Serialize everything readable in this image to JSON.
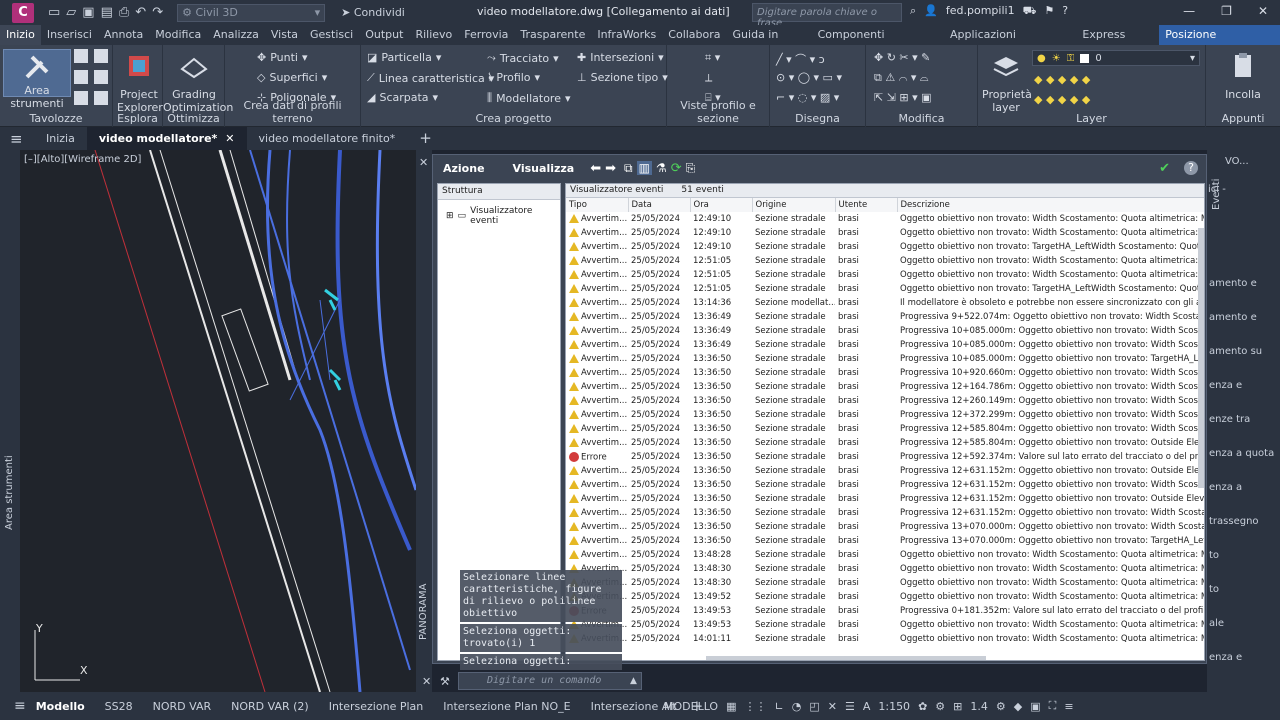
{
  "titlebar": {
    "app_letter": "C",
    "workspace": "Civil 3D",
    "share": "Condividi",
    "document_title": "video modellatore.dwg [Collegamento ai dati]",
    "search_placeholder": "Digitare parola chiave o frase",
    "user": "fed.pompili1"
  },
  "ribbon_tabs": [
    "Inizio",
    "Inserisci",
    "Annota",
    "Modifica",
    "Analizza",
    "Vista",
    "Gestisci",
    "Output",
    "Rilievo",
    "Ferrovia",
    "Trasparente",
    "InfraWorks",
    "Collabora",
    "Guida in linea",
    "Componenti aggiuntivi",
    "Applicazioni disponibili",
    "Express Tools",
    "Posizione geografica"
  ],
  "ribbon": {
    "area_strumenti": "Area strumenti",
    "project_explorer": "Project Explorer",
    "grading_optimization": "Grading Optimization",
    "punti": "Punti",
    "superfici": "Superfici",
    "poligonale": "Poligonale",
    "particella": "Particella",
    "linea_caratteristica": "Linea caratteristica",
    "scarpata": "Scarpata",
    "tracciato": "Tracciato",
    "profilo": "Profilo",
    "modellatore": "Modellatore",
    "intersezioni": "Intersezioni",
    "sezione_tipo": "Sezione tipo",
    "proprieta_layer": "Proprietà layer",
    "incolla": "Incolla",
    "layer_value": "0",
    "groups": {
      "tavolozze": "Tavolozze",
      "esplora": "Esplora",
      "ottimizza": "Ottimizza",
      "crea_dati": "Crea dati di profili terreno",
      "crea_progetto": "Crea progetto",
      "viste_profilo": "Viste profilo e sezione",
      "disegna": "Disegna",
      "modifica": "Modifica",
      "layer": "Layer",
      "appunti": "Appunti"
    }
  },
  "doc_tabs": [
    "Inizia",
    "video modellatore*",
    "video modellatore finito*"
  ],
  "viewport": {
    "label": "[–][Alto][Wireframe 2D]",
    "side_label": "Area strumenti",
    "axis_y": "Y",
    "axis_x": "X"
  },
  "panorama": {
    "label": "PANORAMA",
    "azione": "Azione",
    "visualizza": "Visualizza",
    "struttura": "Struttura",
    "tree_node": "Visualizzatore eventi",
    "header_title": "Visualizzatore eventi",
    "header_count": "51 eventi",
    "columns": [
      "Tipo",
      "Data",
      "Ora",
      "Origine",
      "Utente",
      "Descrizione"
    ],
    "rows": [
      [
        "w",
        "Avvertim...",
        "25/05/2024",
        "12:49:10",
        "Sezione stradale",
        "brasi",
        "Oggetto obiettivo non trovato: Width Scostamento: Quota altimetrica: Mode"
      ],
      [
        "w",
        "Avvertim...",
        "25/05/2024",
        "12:49:10",
        "Sezione stradale",
        "brasi",
        "Oggetto obiettivo non trovato: Width Scostamento: Quota altimetrica: Mode"
      ],
      [
        "w",
        "Avvertim...",
        "25/05/2024",
        "12:49:10",
        "Sezione stradale",
        "brasi",
        "Oggetto obiettivo non trovato: TargetHA_LeftWidth Scostamento: Quota alti"
      ],
      [
        "w",
        "Avvertim...",
        "25/05/2024",
        "12:51:05",
        "Sezione stradale",
        "brasi",
        "Oggetto obiettivo non trovato: Width Scostamento: Quota altimetrica: Mode"
      ],
      [
        "w",
        "Avvertim...",
        "25/05/2024",
        "12:51:05",
        "Sezione stradale",
        "brasi",
        "Oggetto obiettivo non trovato: Width Scostamento: Quota altimetrica: Mode"
      ],
      [
        "w",
        "Avvertim...",
        "25/05/2024",
        "12:51:05",
        "Sezione stradale",
        "brasi",
        "Oggetto obiettivo non trovato: TargetHA_LeftWidth Scostamento: Quota alti"
      ],
      [
        "w",
        "Avvertim...",
        "25/05/2024",
        "13:14:36",
        "Sezione modellat...",
        "brasi",
        "Il modellatore è obsoleto e potrebbe non essere sincronizzato con gli altri o"
      ],
      [
        "w",
        "Avvertim...",
        "25/05/2024",
        "13:36:49",
        "Sezione stradale",
        "brasi",
        "Progressiva 9+522.074m: Oggetto obiettivo non trovato: Width Scostamento"
      ],
      [
        "w",
        "Avvertim...",
        "25/05/2024",
        "13:36:49",
        "Sezione stradale",
        "brasi",
        "Progressiva 10+085.000m: Oggetto obiettivo non trovato: Width Scostamen"
      ],
      [
        "w",
        "Avvertim...",
        "25/05/2024",
        "13:36:49",
        "Sezione stradale",
        "brasi",
        "Progressiva 10+085.000m: Oggetto obiettivo non trovato: Width Scostamen"
      ],
      [
        "w",
        "Avvertim...",
        "25/05/2024",
        "13:36:50",
        "Sezione stradale",
        "brasi",
        "Progressiva 10+085.000m: Oggetto obiettivo non trovato: TargetHA_LeftWi"
      ],
      [
        "w",
        "Avvertim...",
        "25/05/2024",
        "13:36:50",
        "Sezione stradale",
        "brasi",
        "Progressiva 10+920.660m: Oggetto obiettivo non trovato: Width Scostamen"
      ],
      [
        "w",
        "Avvertim...",
        "25/05/2024",
        "13:36:50",
        "Sezione stradale",
        "brasi",
        "Progressiva 12+164.786m: Oggetto obiettivo non trovato: Width Scostamen"
      ],
      [
        "w",
        "Avvertim...",
        "25/05/2024",
        "13:36:50",
        "Sezione stradale",
        "brasi",
        "Progressiva 12+260.149m: Oggetto obiettivo non trovato: Width Scostamen"
      ],
      [
        "w",
        "Avvertim...",
        "25/05/2024",
        "13:36:50",
        "Sezione stradale",
        "brasi",
        "Progressiva 12+372.299m: Oggetto obiettivo non trovato: Width Scostamen"
      ],
      [
        "w",
        "Avvertim...",
        "25/05/2024",
        "13:36:50",
        "Sezione stradale",
        "brasi",
        "Progressiva 12+585.804m: Oggetto obiettivo non trovato: Width Scostamen"
      ],
      [
        "w",
        "Avvertim...",
        "25/05/2024",
        "13:36:50",
        "Sezione stradale",
        "brasi",
        "Progressiva 12+585.804m: Oggetto obiettivo non trovato: Outside Elevation"
      ],
      [
        "e",
        "Errore",
        "25/05/2024",
        "13:36:50",
        "Sezione stradale",
        "brasi",
        "Progressiva 12+592.374m: Valore sul lato errato del tracciato o del profilo:"
      ],
      [
        "w",
        "Avvertim...",
        "25/05/2024",
        "13:36:50",
        "Sezione stradale",
        "brasi",
        "Progressiva 12+631.152m: Oggetto obiettivo non trovato: Outside Elevation"
      ],
      [
        "w",
        "Avvertim...",
        "25/05/2024",
        "13:36:50",
        "Sezione stradale",
        "brasi",
        "Progressiva 12+631.152m: Oggetto obiettivo non trovato: Width Scostamen"
      ],
      [
        "w",
        "Avvertim...",
        "25/05/2024",
        "13:36:50",
        "Sezione stradale",
        "brasi",
        "Progressiva 12+631.152m: Oggetto obiettivo non trovato: Outside Elevation"
      ],
      [
        "w",
        "Avvertim...",
        "25/05/2024",
        "13:36:50",
        "Sezione stradale",
        "brasi",
        "Progressiva 12+631.152m: Oggetto obiettivo non trovato: Width Scostamen"
      ],
      [
        "w",
        "Avvertim...",
        "25/05/2024",
        "13:36:50",
        "Sezione stradale",
        "brasi",
        "Progressiva 13+070.000m: Oggetto obiettivo non trovato: Width Scostamen"
      ],
      [
        "w",
        "Avvertim...",
        "25/05/2024",
        "13:36:50",
        "Sezione stradale",
        "brasi",
        "Progressiva 13+070.000m: Oggetto obiettivo non trovato: TargetHA_LeftWi"
      ],
      [
        "w",
        "Avvertim...",
        "25/05/2024",
        "13:48:28",
        "Sezione stradale",
        "brasi",
        "Oggetto obiettivo non trovato: Width Scostamento: Quota altimetrica: Mode"
      ],
      [
        "w",
        "Avvertim...",
        "25/05/2024",
        "13:48:30",
        "Sezione stradale",
        "brasi",
        "Oggetto obiettivo non trovato: Width Scostamento: Quota altimetrica: Mode"
      ],
      [
        "w",
        "Avvertim...",
        "25/05/2024",
        "13:48:30",
        "Sezione stradale",
        "brasi",
        "Oggetto obiettivo non trovato: Width Scostamento: Quota altimetrica: Mode"
      ],
      [
        "w",
        "Avvertim...",
        "25/05/2024",
        "13:49:52",
        "Sezione stradale",
        "brasi",
        "Oggetto obiettivo non trovato: Width Scostamento: Quota altimetrica: Mode"
      ],
      [
        "e",
        "Errore",
        "25/05/2024",
        "13:49:53",
        "Sezione stradale",
        "brasi",
        "Progressiva 0+181.352m: Valore sul lato errato del tracciato o del profilo: V"
      ],
      [
        "w",
        "Avvertim...",
        "25/05/2024",
        "13:49:53",
        "Sezione stradale",
        "brasi",
        "Oggetto obiettivo non trovato: Width Scostamento: Quota altimetrica: Mode"
      ],
      [
        "w",
        "Avvertim...",
        "25/05/2024",
        "14:01:11",
        "Sezione stradale",
        "brasi",
        "Oggetto obiettivo non trovato: Width Scostamento: Quota altimetrica: Mode"
      ]
    ]
  },
  "command": {
    "history": [
      "Selezionare linee caratteristiche, figure di rilievo o polilinee obiettivo",
      "Seleziona oggetti: trovato(i) 1",
      "Seleziona oggetti:"
    ],
    "placeholder": "Digitare un comando"
  },
  "right_panel": {
    "title": "VO...",
    "tab": "Eventi",
    "items": [
      "ici -",
      "amento e",
      "amento e",
      "amento su",
      "enza e",
      "enze tra",
      "enza a quota",
      "enza a",
      "trassegno",
      "to",
      "to",
      "ale",
      "enza e",
      "pendenza"
    ]
  },
  "statusbar": {
    "tabs": [
      "Modello",
      "SS28",
      "NORD VAR",
      "NORD VAR (2)",
      "Intersezione Plan",
      "Intersezione Plan NO_E",
      "Intersezione Alt"
    ],
    "mode": "MODELLO",
    "scale": "1:150",
    "value": "1.4"
  },
  "colors": {
    "accent": "#2f5fa6",
    "warning": "#e5b824",
    "error": "#d23b3b"
  }
}
